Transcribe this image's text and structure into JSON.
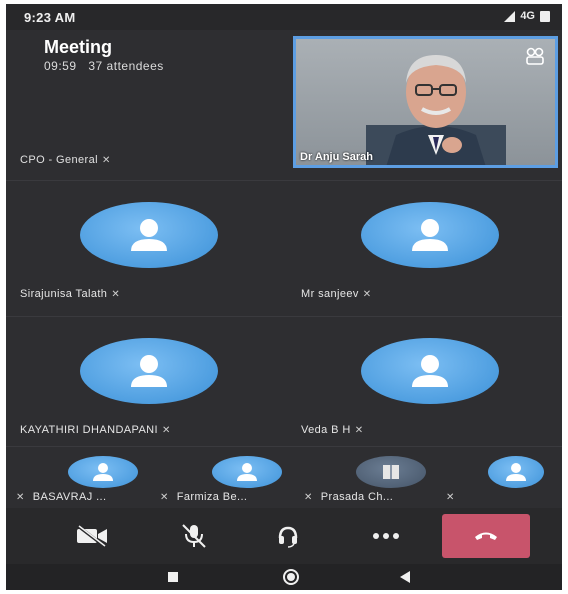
{
  "status_bar": {
    "time": "9:23 AM",
    "network": "4G"
  },
  "meeting": {
    "title": "Meeting",
    "duration": "09:59",
    "attendees": "37 attendees"
  },
  "active_speaker": {
    "name": "Dr Anju Sarah"
  },
  "channel": {
    "label": "CPO - General"
  },
  "participants_large": [
    {
      "name": "Sirajunisa Talath"
    },
    {
      "name": "Mr sanjeev"
    },
    {
      "name": "KAYATHIRI DHANDAPANI"
    },
    {
      "name": "Veda B H"
    }
  ],
  "participants_row": [
    {
      "name": "BASAVRAJ ..."
    },
    {
      "name": "Farmiza Be..."
    },
    {
      "name": "Prasada Ch..."
    },
    {
      "name": ""
    }
  ],
  "controls": [
    "camera-off-icon",
    "mic-muted-icon",
    "headset-icon",
    "more-icon",
    "hang-up-icon"
  ],
  "colors": {
    "background": "#2e2e31",
    "avatar": "#4e9ee0",
    "leave": "#c8546b",
    "video_border": "#5d9ee3"
  }
}
